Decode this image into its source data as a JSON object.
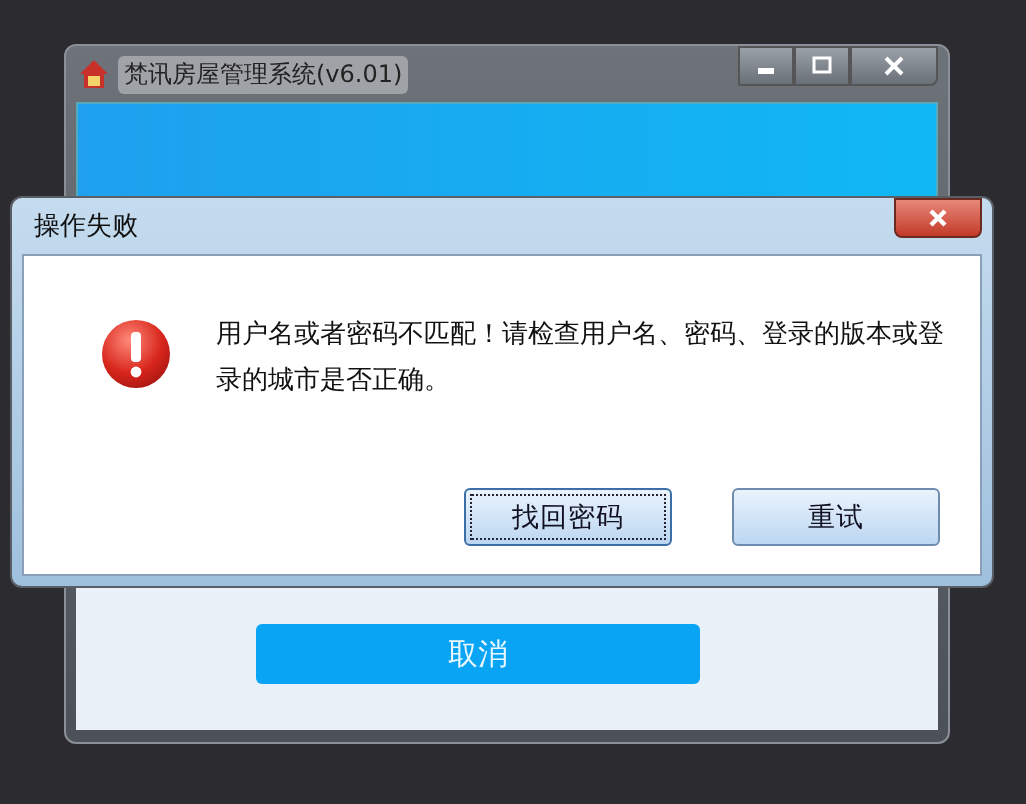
{
  "main_window": {
    "title": "梵讯房屋管理系统(v6.01)",
    "cancel_button": "取消"
  },
  "dialog": {
    "title": "操作失败",
    "message": "用户名或者密码不匹配！请检查用户名、密码、登录的版本或登录的城市是否正确。",
    "buttons": [
      {
        "label": "找回密码",
        "focused": true
      },
      {
        "label": "重试",
        "focused": false
      }
    ]
  }
}
